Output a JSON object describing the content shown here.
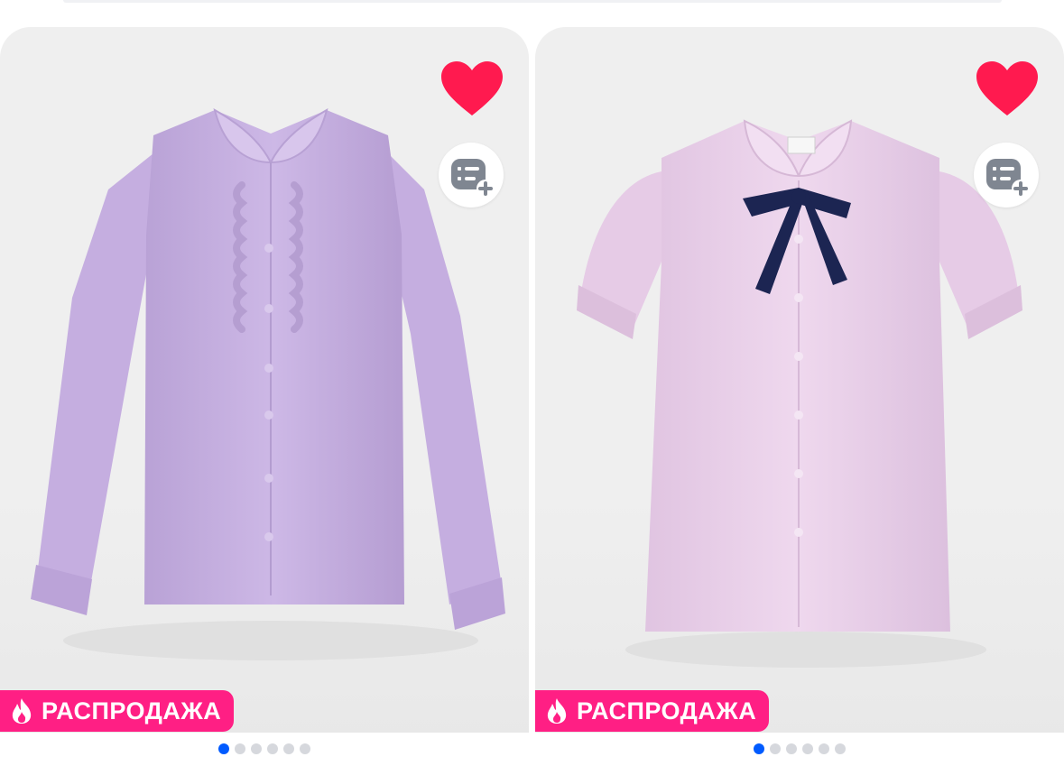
{
  "products": [
    {
      "badge": {
        "label": "РАСПРОДАЖА",
        "icon": "flame-icon"
      },
      "favorite": {
        "icon": "heart-icon",
        "active": true
      },
      "compare": {
        "icon": "compare-add-icon"
      },
      "image": {
        "subject": "lilac long-sleeve ruffle blouse"
      },
      "gallery": {
        "count": 6,
        "active_index": 0
      }
    },
    {
      "badge": {
        "label": "РАСПРОДАЖА",
        "icon": "flame-icon"
      },
      "favorite": {
        "icon": "heart-icon",
        "active": true
      },
      "compare": {
        "icon": "compare-add-icon"
      },
      "image": {
        "subject": "pink short-sleeve blouse with navy bow"
      },
      "gallery": {
        "count": 6,
        "active_index": 0
      }
    }
  ],
  "colors": {
    "sale_badge": "#ff1f84",
    "heart": "#ff1a4f",
    "dot_active": "#005bff",
    "dot_inactive": "#d6d8dd",
    "card_bg": "#efefef",
    "shirt_left": "#c9b3e2",
    "shirt_right": "#e8cde8",
    "bow": "#1c2552"
  }
}
